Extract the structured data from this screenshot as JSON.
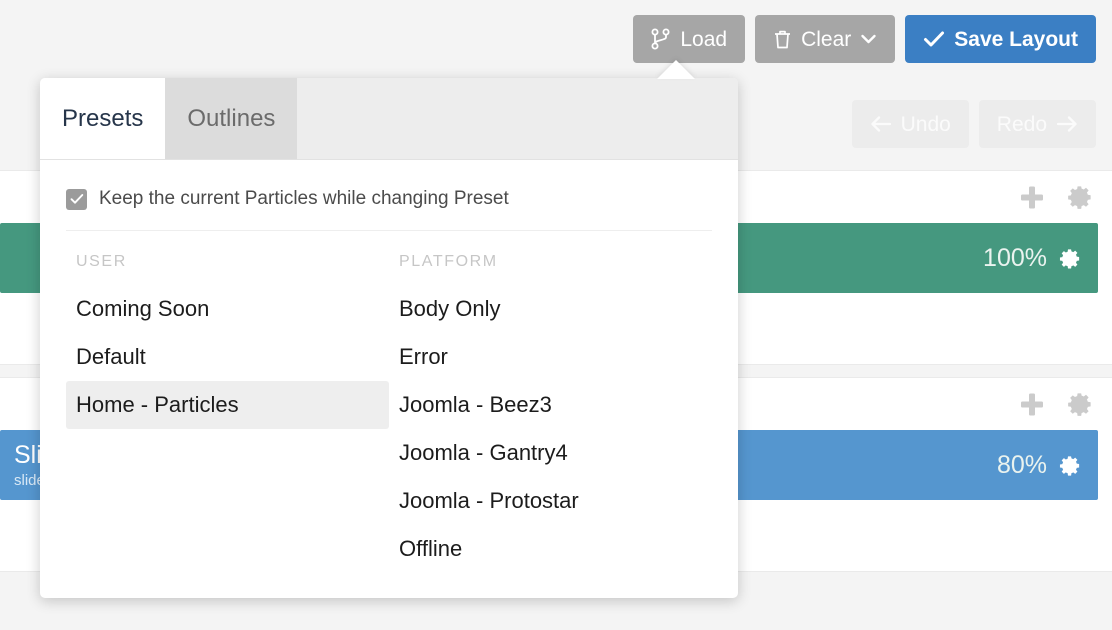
{
  "toolbar": {
    "load_label": "Load",
    "load_icon": "code-branch-icon",
    "clear_label": "Clear",
    "clear_icon": "trash-icon",
    "clear_caret": "⌄",
    "save_label": "Save Layout",
    "save_icon": "check-icon",
    "save_color": "#3b7fc4"
  },
  "history": {
    "undo_label": "Undo",
    "undo_icon": "arrow-left-icon",
    "redo_label": "Redo",
    "redo_icon": "arrow-right-icon"
  },
  "sections": [
    {
      "add_icon": "plus-icon",
      "settings_icon": "gear-icon",
      "block": {
        "title": "",
        "subtitle": "",
        "percent": "100%",
        "color": "#45987f",
        "gear_icon": "gear-icon"
      }
    },
    {
      "add_icon": "plus-icon",
      "settings_icon": "gear-icon",
      "block": {
        "title": "Slider",
        "subtitle": "slideshow",
        "percent": "80%",
        "color": "#5596cf",
        "gear_icon": "gear-icon"
      }
    }
  ],
  "popover": {
    "tabs": [
      {
        "label": "Presets",
        "active": true
      },
      {
        "label": "Outlines",
        "active": false
      }
    ],
    "keep_particles": {
      "label": "Keep the current Particles while changing Preset",
      "checked": true,
      "check_icon": "checkmark-icon"
    },
    "columns": [
      {
        "header": "USER",
        "items": [
          {
            "label": "Coming Soon",
            "hover": false
          },
          {
            "label": "Default",
            "hover": false
          },
          {
            "label": "Home - Particles",
            "hover": true
          }
        ]
      },
      {
        "header": "PLATFORM",
        "items": [
          {
            "label": "Body Only",
            "hover": false
          },
          {
            "label": "Error",
            "hover": false
          },
          {
            "label": "Joomla - Beez3",
            "hover": false
          },
          {
            "label": "Joomla - Gantry4",
            "hover": false
          },
          {
            "label": "Joomla - Protostar",
            "hover": false
          },
          {
            "label": "Offline",
            "hover": false
          }
        ]
      }
    ]
  }
}
